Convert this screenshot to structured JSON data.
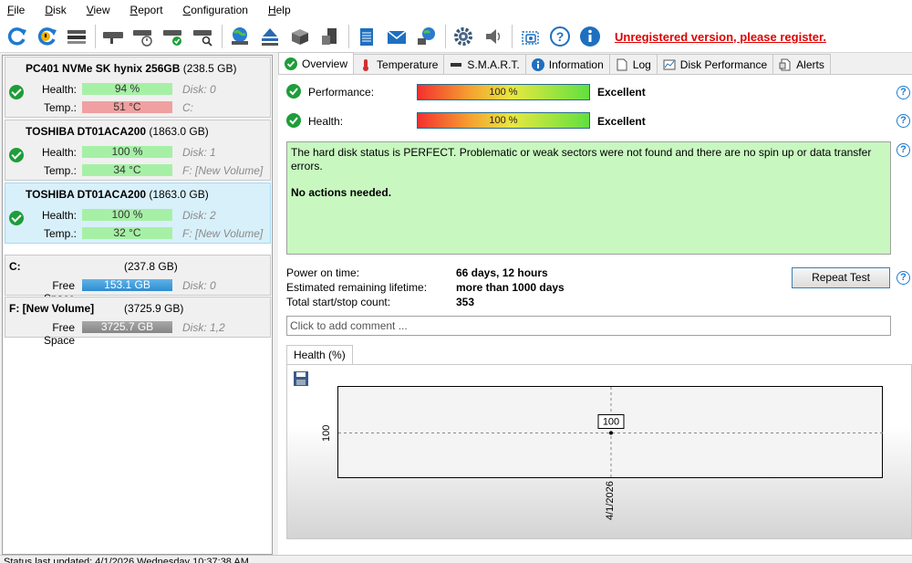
{
  "menu": [
    "File",
    "Disk",
    "View",
    "Report",
    "Configuration",
    "Help"
  ],
  "menu_underline": [
    "F",
    "D",
    "V",
    "R",
    "C",
    "H"
  ],
  "unregistered_text": "Unregistered version, please register.",
  "disks": [
    {
      "name": "PC401 NVMe SK hynix 256GB",
      "size": "(238.5 GB)",
      "health_label": "Health:",
      "health": "94 %",
      "health_level": 94,
      "temp_label": "Temp.:",
      "temp": "51 °C",
      "disk_no": "Disk: 0",
      "volumes": "C:"
    },
    {
      "name": "TOSHIBA DT01ACA200",
      "size": "(1863.0 GB)",
      "health_label": "Health:",
      "health": "100 %",
      "health_level": 100,
      "temp_label": "Temp.:",
      "temp": "34 °C",
      "disk_no": "Disk: 1",
      "volumes": "F: [New Volume]"
    },
    {
      "name": "TOSHIBA DT01ACA200",
      "size": "(1863.0 GB)",
      "health_label": "Health:",
      "health": "100 %",
      "health_level": 100,
      "temp_label": "Temp.:",
      "temp": "32 °C",
      "disk_no": "Disk: 2",
      "volumes": "F: [New Volume]"
    }
  ],
  "volumes": [
    {
      "name": "C:",
      "size": "(237.8 GB)",
      "free_label": "Free Space",
      "free": "153.1 GB",
      "free_fraction": 0.64,
      "disk_no": "Disk: 0"
    },
    {
      "name": "F: [New Volume]",
      "size": "(3725.9 GB)",
      "free_label": "Free Space",
      "free": "3725.7 GB",
      "free_fraction": 1.0,
      "disk_no": "Disk: 1,2"
    }
  ],
  "tabs": [
    {
      "label": "Overview",
      "icon": "check-icon"
    },
    {
      "label": "Temperature",
      "icon": "thermometer-icon"
    },
    {
      "label": "S.M.A.R.T.",
      "icon": "dash-icon"
    },
    {
      "label": "Information",
      "icon": "info-icon"
    },
    {
      "label": "Log",
      "icon": "document-icon"
    },
    {
      "label": "Disk Performance",
      "icon": "chart-icon"
    },
    {
      "label": "Alerts",
      "icon": "alerts-icon"
    }
  ],
  "overview": {
    "performance_label": "Performance:",
    "performance_value": "100 %",
    "performance_level": 100,
    "performance_grade": "Excellent",
    "health_label": "Health:",
    "health_value": "100 %",
    "health_level": 100,
    "health_grade": "Excellent",
    "status_text": "The hard disk status is PERFECT. Problematic or weak sectors were not found and there are no spin up or data transfer errors.",
    "action_text": "No actions needed.",
    "power_on_label": "Power on time:",
    "power_on_value": "66 days, 12 hours",
    "lifetime_label": "Estimated remaining lifetime:",
    "lifetime_value": "more than 1000 days",
    "startstop_label": "Total start/stop count:",
    "startstop_value": "353",
    "repeat_test": "Repeat Test",
    "comment_placeholder": "Click to add comment ...",
    "help_glyph": "?"
  },
  "chart_tab": "Health (%)",
  "chart_data": {
    "type": "line",
    "x": [
      "4/1/2026"
    ],
    "series": [
      {
        "values": [
          100
        ]
      }
    ],
    "data_labels": [
      "100"
    ],
    "y_tick_labels": [
      "100"
    ],
    "x_tick_labels": [
      "4/1/2026"
    ],
    "xlabel": "",
    "ylabel": "",
    "grid": true
  },
  "statusbar_text": "Status last updated: 4/1/2026 Wednesday 10:37:38 AM"
}
